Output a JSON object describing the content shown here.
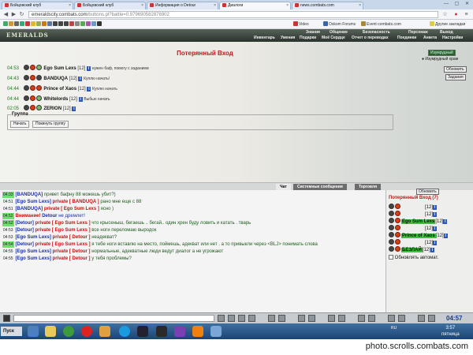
{
  "browser": {
    "tabs": [
      {
        "label": "Бойцовский клуб"
      },
      {
        "label": "Бойцовский клуб"
      },
      {
        "label": "Информация о Detour"
      },
      {
        "label": "Диалоги"
      },
      {
        "label": "news.combats.com"
      }
    ],
    "url_host": "emeraldscity.combats.com",
    "url_path": "/buttons.pl?battle=0.979690582876902",
    "bookmarks": [
      "Video",
      "Oskom Forums",
      "Event combats.com",
      "Другие закладки"
    ]
  },
  "game": {
    "logo": "EMERALDS",
    "menu_top": [
      "Знания",
      "Общение",
      "Безопасность",
      "Персонаж",
      "Выход"
    ],
    "menu_bottom": [
      "Инвентарь",
      "Умения",
      "Подарки",
      "Моё Сердце",
      "Отчет о переводах",
      "Поединки",
      "Анкета",
      "Настройки"
    ]
  },
  "fight": {
    "title": "Потерянный Вход",
    "participants": [
      {
        "time": "04:53",
        "name": "Ego Sum Lexs",
        "level": "[12]",
        "message": "нужен баф, помогу с заданием"
      },
      {
        "time": "04:43",
        "name": "BANDUQA",
        "level": "[12]",
        "message": "Куплю начать!"
      },
      {
        "time": "04:44",
        "name": "Prince of Xaos",
        "level": "[12]",
        "message": "Куплю начать"
      },
      {
        "time": "04:44",
        "name": "Whitelords",
        "level": "[12]",
        "message": "Выбью начать"
      },
      {
        "time": "02:05",
        "name": "ZERION",
        "level": "[12]",
        "message": ""
      }
    ],
    "group_label": "Группа",
    "btn_start": "Начать",
    "btn_leave": "Покинуть группу",
    "right_top": "Изумрудный",
    "right_link": "Изумрудный храм",
    "btn_refresh": "Обновить",
    "btn_tasks": "Задания"
  },
  "chat": {
    "tabs": [
      "Чат",
      "Системные сообщения",
      "Торговля"
    ],
    "lines": [
      {
        "time": "04:33",
        "sender": "[BANDUQA]",
        "prefix": "",
        "target": "",
        "text": "привет бафну 88 можешь убит?)",
        "hl": true
      },
      {
        "time": "04:51",
        "sender": "[Ego Sum Lexs]",
        "prefix": "private",
        "target": "[ BANDUQA ]",
        "text": "рано мне еще с 88",
        "hl": false
      },
      {
        "time": "04:51",
        "sender": "[BANDUQA]",
        "prefix": "private",
        "target": "[ Ego Sum Lexs ]",
        "text": "ясно )",
        "hl": false
      },
      {
        "time": "04:52",
        "sender": "",
        "prefix": "Внимание!",
        "target": "Detour",
        "text": "не дремлет!",
        "hl": true
      },
      {
        "time": "04:52",
        "sender": "[Detour]",
        "prefix": "private",
        "target": "[ Ego Sum Lexs ]",
        "text": "что крысеныш, бегаешь .. бегай.. один хрен буду ловить и катать . тварь",
        "hl": true
      },
      {
        "time": "04:53",
        "sender": "[Detour]",
        "prefix": "private",
        "target": "[ Ego Sum Lexs ]",
        "text": "все ноги переломаю выродок",
        "hl": false
      },
      {
        "time": "04:53",
        "sender": "[Ego Sum Lexs]",
        "prefix": "private",
        "target": "[ Detour ]",
        "text": "неадекват?",
        "hl": false
      },
      {
        "time": "04:54",
        "sender": "[Detour]",
        "prefix": "private",
        "target": "[ Ego Sum Lexs ]",
        "text": "я тебе ноги вставлю на место, поймешь, адекват или нет . а то привыкли через <BLJ> понимать слова",
        "hl": true
      },
      {
        "time": "04:55",
        "sender": "[Ego Sum Lexs]",
        "prefix": "private",
        "target": "[ Detour ]",
        "text": "нормальные, адекватные люди ведут диалог а не угрожают",
        "hl": false
      },
      {
        "time": "04:55",
        "sender": "[Ego Sum Lexs]",
        "prefix": "private",
        "target": "[ Detour ]",
        "text": "у тебя проблемы?",
        "hl": false
      }
    ]
  },
  "online": {
    "btn_refresh": "Обновить",
    "title": "Потерянный Вход (7)",
    "users": [
      {
        "name": "",
        "level": "[12]",
        "bg": "#c0252b"
      },
      {
        "name": "",
        "level": "[12]",
        "bg": "#c0252b"
      },
      {
        "name": "Ego Sum Lexs",
        "level": "[12]",
        "bg": "#3fbf3f"
      },
      {
        "name": "",
        "level": "[12]",
        "bg": "#c0252b"
      },
      {
        "name": "Prince of Xaos",
        "level": "[12]",
        "bg": "#3fbf3f"
      },
      {
        "name": "",
        "level": "[12]",
        "bg": "#c0252b"
      },
      {
        "name": "БЕЗЛАЙ",
        "level": "[12]",
        "bg": "#3fbf3f"
      }
    ],
    "auto_refresh_label": "Обновлять автомат."
  },
  "toolbar": {
    "clock": "04:57"
  },
  "taskbar": {
    "start": "Пуск",
    "lang": "RU",
    "time": "3:57",
    "day": "пятница"
  },
  "watermark": "photo.scrolls.combats.com"
}
